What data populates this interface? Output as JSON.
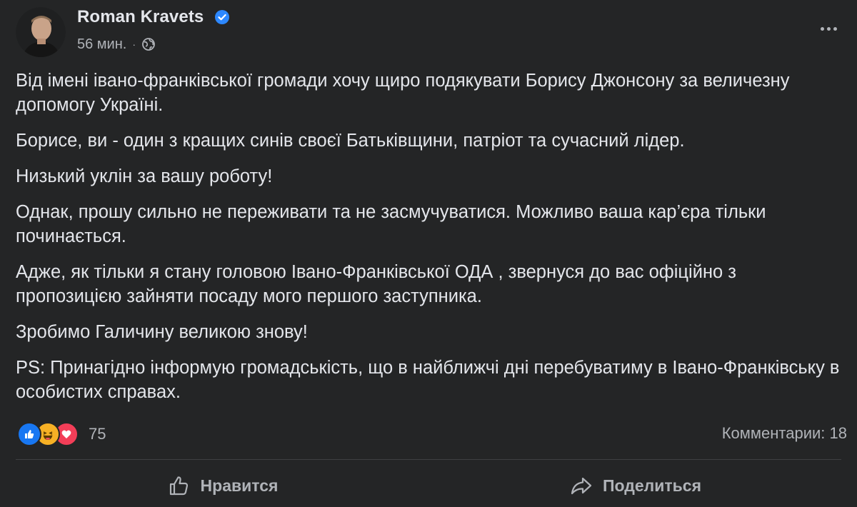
{
  "post": {
    "author": "Roman Kravets",
    "time": "56 мин.",
    "separator": "·",
    "paragraphs": [
      "Від імені івано-франківської громади хочу щиро подякувати Борису Джонсону за величезну допомогу Україні.",
      "Борисе, ви - один з кращих синів своєї Батьківщини, патріот та сучасний лідер.",
      "Низький уклін за вашу роботу!",
      "Однак, прошу сильно не переживати та не засмучуватися. Можливо ваша кар’єра тільки починається.",
      "Адже, як тільки я стану головою Івано-Франківської ОДА , звернуся до вас офіційно з пропозицією зайняти посаду мого першого заступника.",
      "Зробимо Галичину великою знову!",
      "PS: Принагідно інформую громадськість, що в найближчі дні перебуватиму в Івано-Франківську в особистих справах."
    ]
  },
  "reactions": {
    "icons": [
      "like-icon",
      "haha-icon",
      "love-icon"
    ],
    "count": "75",
    "comments_label": "Комментарии: 18"
  },
  "actions": {
    "like_label": "Нравится",
    "share_label": "Поделиться"
  },
  "colors": {
    "background": "#242526",
    "text_primary": "#e4e6eb",
    "text_secondary": "#b0b3b8",
    "verified": "#2d88ff",
    "like": "#1877f2",
    "haha": "#f7b125",
    "love": "#f33e58"
  }
}
